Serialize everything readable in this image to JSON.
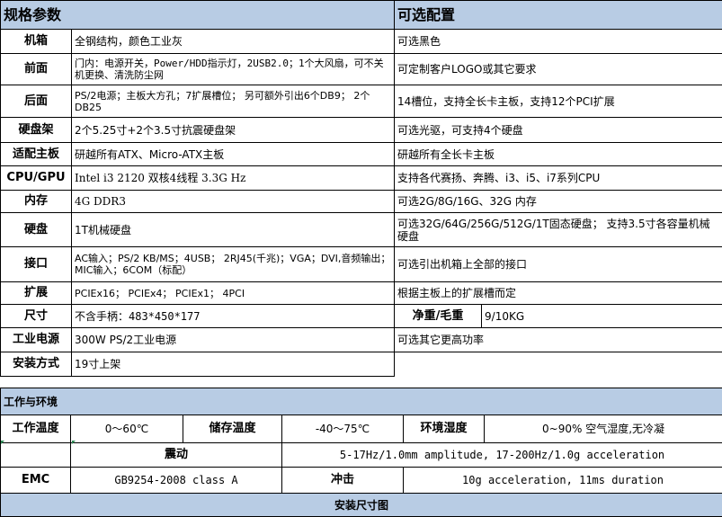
{
  "spec": {
    "header_left": "规格参数",
    "header_right": "可选配置",
    "rows": [
      {
        "label": "机箱",
        "value": "全钢结构，颜色工业灰",
        "option": "可选黑色"
      },
      {
        "label": "前面",
        "value": "门内：电源开关，Power/HDD指示灯，2USB2.0；1个大风扇，可不关机更换、清洗防尘网",
        "option": "可定制客户LOGO或其它要求"
      },
      {
        "label": "后面",
        "value": "PS/2电源；主板大方孔；7扩展槽位； 另可额外引出6个DB9； 2个DB25",
        "option": "14槽位，支持全长卡主板，支持12个PCI扩展"
      },
      {
        "label": "硬盘架",
        "value": "2个5.25寸+2个3.5寸抗震硬盘架",
        "option": "可选光驱，可支持4个硬盘"
      },
      {
        "label": "适配主板",
        "value": "研越所有ATX、Micro-ATX主板",
        "option": "研越所有全长卡主板"
      },
      {
        "label": "CPU/GPU",
        "value": "Intel i3 2120 双核4线程 3.3G Hz",
        "option": "支持各代赛扬、奔腾、i3、i5、i7系列CPU"
      },
      {
        "label": "内存",
        "value": "4G DDR3",
        "option": "可选2G/8G/16G、32G 内存"
      },
      {
        "label": "硬盘",
        "value": "1T机械硬盘",
        "option": "可选32G/64G/256G/512G/1T固态硬盘； 支持3.5寸各容量机械硬盘"
      },
      {
        "label": "接口",
        "value": "AC输入；PS/2 KB/MS；4USB； 2RJ45(千兆)；VGA；DVI,音频输出；MIC输入；6COM（标配）",
        "option": "可选引出机箱上全部的接口"
      },
      {
        "label": "扩展",
        "value": "PCIEx16； PCIEx4； PCIEx1； 4PCI",
        "option": "根据主板上的扩展槽而定"
      }
    ],
    "size": {
      "label": "尺寸",
      "value": "不含手柄：483*450*177",
      "weight_label": "净重/毛重",
      "weight_value": "9/10KG"
    },
    "power": {
      "label": "工业电源",
      "value": "300W PS/2工业电源",
      "option": "可选其它更高功率"
    },
    "mount": {
      "label": "安装方式",
      "value": "19寸上架"
    }
  },
  "env": {
    "header": "工作与环境",
    "work_temp_label": "工作温度",
    "work_temp_value": "0～60℃",
    "store_temp_label": "储存温度",
    "store_temp_value": "-40～75℃",
    "humidity_label": "环境湿度",
    "humidity_value": "0~90% 空气湿度,无冷凝",
    "vibration_label": "震动",
    "vibration_value": "5-17Hz/1.0mm amplitude, 17-200Hz/1.0g acceleration",
    "emc_label": "EMC",
    "emc_value": "GB9254-2008 class A",
    "shock_label": "冲击",
    "shock_value": "10g acceleration, 11ms duration"
  },
  "install": {
    "header": "安装尺寸图"
  }
}
